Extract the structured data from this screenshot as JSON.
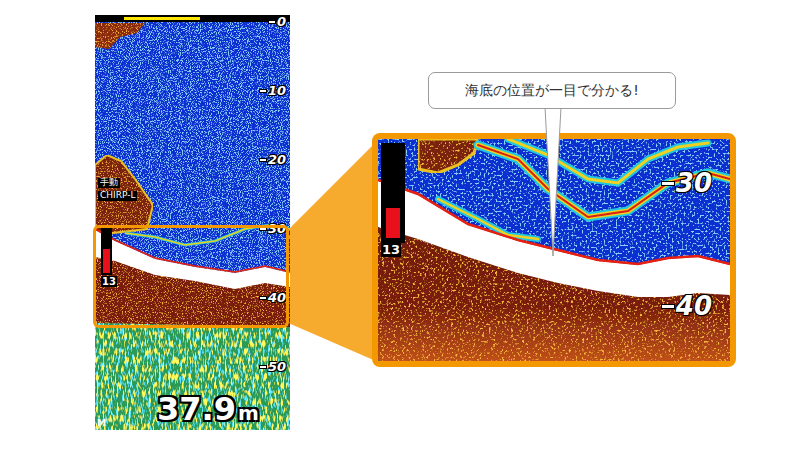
{
  "display": {
    "scroll_bar": {
      "level": 0.39
    },
    "mode_badge": "手動",
    "mode": "CHIRP-L",
    "gain": {
      "level": 0.6,
      "reading": "13"
    },
    "depth_ticks": [
      "0",
      "10",
      "20",
      "30",
      "40",
      "50"
    ],
    "depth_reading": "37.9",
    "depth_unit": "m",
    "corner_mark": "M"
  },
  "zoom": {
    "gain": {
      "level": 0.4,
      "reading": "13"
    },
    "depth_ticks": [
      "30",
      "40"
    ]
  },
  "callout": {
    "text": "海底の位置が一目で分かる!"
  }
}
